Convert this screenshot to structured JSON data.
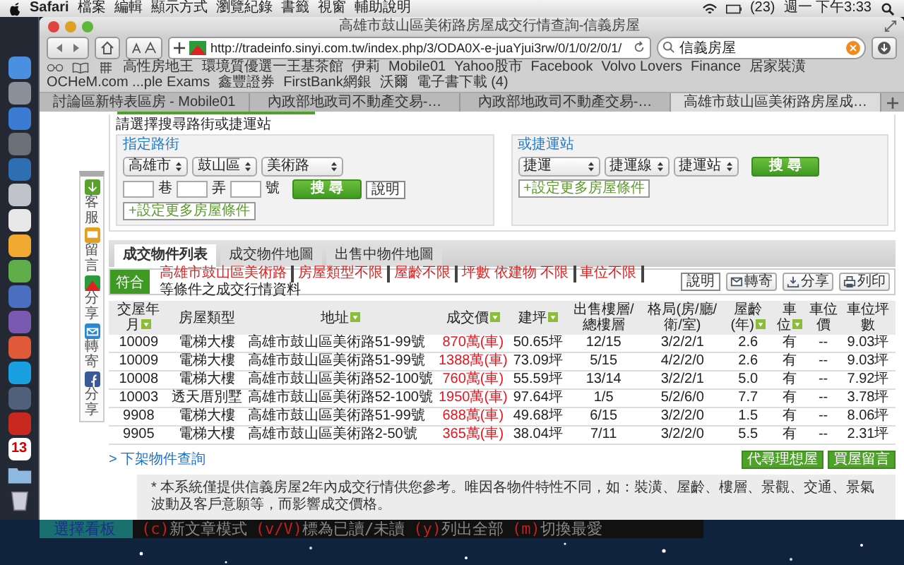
{
  "menubar": {
    "app": "Safari",
    "menus": [
      "檔案",
      "編輯",
      "顯示方式",
      "瀏覽紀錄",
      "書籤",
      "視窗",
      "輔助說明"
    ],
    "battery": "(23)",
    "clock": "週一 下午3:33"
  },
  "dock": {
    "calendar_day": "13"
  },
  "browser": {
    "title": "高雄市鼓山區美術路房屋成交行情查詢-信義房屋",
    "url": "http://tradeinfo.sinyi.com.tw/index.php/3/ODA0X-e-juaYjui3rw/0/1/0/2/0/1/",
    "search": "信義房屋",
    "bookmarks": [
      "高性房地王",
      "環境質優選一王基茶館",
      "伊莉",
      "Mobile01",
      "Yahoo股市",
      "Facebook",
      "Volvo Lovers",
      "Finance",
      "居家裝潢",
      "OCHeM.com ...ple Exams",
      "鑫豐證券",
      "FirstBank網銀",
      "沃爾",
      "電子書下載 (4)"
    ],
    "tabs": [
      {
        "label": "討論區新特表區房 - Mobile01",
        "selected": false
      },
      {
        "label": "內政部地政司不動產交易-…",
        "selected": false
      },
      {
        "label": "內政部地政司不動產交易-…",
        "selected": false
      },
      {
        "label": "高雄市鼓山區美術路房屋成…",
        "selected": true
      }
    ]
  },
  "page": {
    "sidebar": [
      {
        "kind": "download",
        "label": "客服"
      },
      {
        "kind": "chat",
        "label": "留言"
      },
      {
        "kind": "share",
        "label": "分享"
      },
      {
        "kind": "mail",
        "label": "轉寄"
      },
      {
        "kind": "facebook",
        "label": "分享"
      }
    ],
    "search": {
      "prompt": "請選擇搜尋路街或捷運站",
      "street": {
        "heading": "指定路街",
        "selects": [
          "高雄市",
          "鼓山區",
          "美術路"
        ],
        "lane_labels": [
          "巷",
          "弄",
          "號"
        ],
        "button": "搜 尋",
        "help": "說明",
        "more": "+設定更多房屋條件"
      },
      "mrt": {
        "heading": "或捷運站",
        "selects": [
          "捷運",
          "捷運線",
          "捷運站"
        ],
        "button": "搜 尋",
        "more": "+設定更多房屋條件"
      }
    },
    "result_tabs": [
      {
        "label": "成交物件列表",
        "selected": true
      },
      {
        "label": "成交物件地圖",
        "selected": false
      },
      {
        "label": "出售中物件地圖",
        "selected": false
      }
    ],
    "filter": {
      "badge": "符合",
      "criteria": [
        "高雄市鼓山區美術路",
        "房屋類型不限",
        "屋齡不限",
        "坪數 依建物 不限",
        "車位不限"
      ],
      "suffix": "等條件之成交行情資料",
      "help": "說明",
      "actions": [
        {
          "kind": "mail",
          "label": "轉寄"
        },
        {
          "kind": "share",
          "label": "分享"
        },
        {
          "kind": "print",
          "label": "列印"
        }
      ]
    },
    "table": {
      "columns": [
        {
          "label": "交屋年月",
          "sortable": true,
          "emphasis": false
        },
        {
          "label": "房屋類型",
          "sortable": false,
          "emphasis": false
        },
        {
          "label": "地址",
          "sortable": true,
          "emphasis": false
        },
        {
          "label": "成交價",
          "sortable": true,
          "emphasis": true
        },
        {
          "label": "建坪",
          "sortable": true,
          "emphasis": false
        },
        {
          "label": "出售樓層/總樓層",
          "sortable": false,
          "emphasis": false
        },
        {
          "label": "格局(房/廳/衛/室)",
          "sortable": false,
          "emphasis": false
        },
        {
          "label": "屋齡(年)",
          "sortable": true,
          "emphasis": false
        },
        {
          "label": "車位",
          "sortable": true,
          "emphasis": false
        },
        {
          "label": "車位價",
          "sortable": false,
          "emphasis": false
        },
        {
          "label": "車位坪數",
          "sortable": false,
          "emphasis": false
        }
      ],
      "rows": [
        [
          "10009",
          "電梯大樓",
          "高雄市鼓山區美術路51-99號",
          "870萬(車)",
          "50.65坪",
          "12/15",
          "3/2/2/1",
          "2.6",
          "有",
          "--",
          "9.03坪"
        ],
        [
          "10009",
          "電梯大樓",
          "高雄市鼓山區美術路51-99號",
          "1388萬(車)",
          "73.09坪",
          "5/15",
          "4/2/2/0",
          "2.6",
          "有",
          "--",
          "9.03坪"
        ],
        [
          "10008",
          "電梯大樓",
          "高雄市鼓山區美術路52-100號",
          "760萬(車)",
          "55.59坪",
          "13/14",
          "3/2/2/1",
          "5.0",
          "有",
          "--",
          "7.92坪"
        ],
        [
          "10003",
          "透天厝別墅",
          "高雄市鼓山區美術路52-100號",
          "1950萬(車)",
          "97.64坪",
          "1/5",
          "5/2/6/0",
          "7.7",
          "有",
          "--",
          "3.78坪"
        ],
        [
          "9908",
          "電梯大樓",
          "高雄市鼓山區美術路51-99號",
          "688萬(車)",
          "49.68坪",
          "6/15",
          "3/2/2/0",
          "1.5",
          "有",
          "--",
          "8.06坪"
        ],
        [
          "9905",
          "電梯大樓",
          "高雄市鼓山區美術路2-50號",
          "365萬(車)",
          "38.04坪",
          "7/11",
          "3/2/2/0",
          "5.5",
          "有",
          "--",
          "2.31坪"
        ]
      ]
    },
    "delisted_link": "> 下架物件查詢",
    "buttons": [
      "代尋理想屋",
      "買屋留言"
    ],
    "footnote": "* 本系統僅提供信義房屋2年內成交行情供您參考。唯因各物件特性不同，如：裝潢、屋齡、樓層、景觀、交通、景氣波動及客戶意願等，而影響成交價格。"
  },
  "terminal": {
    "title": "選擇看板",
    "hints": [
      {
        "key": "(c)",
        "text": "新文章模式"
      },
      {
        "key": "(v/V)",
        "text": "標為已讀/未讀"
      },
      {
        "key": "(y)",
        "text": "列出全部"
      },
      {
        "key": "(m)",
        "text": "切換最愛"
      }
    ]
  }
}
